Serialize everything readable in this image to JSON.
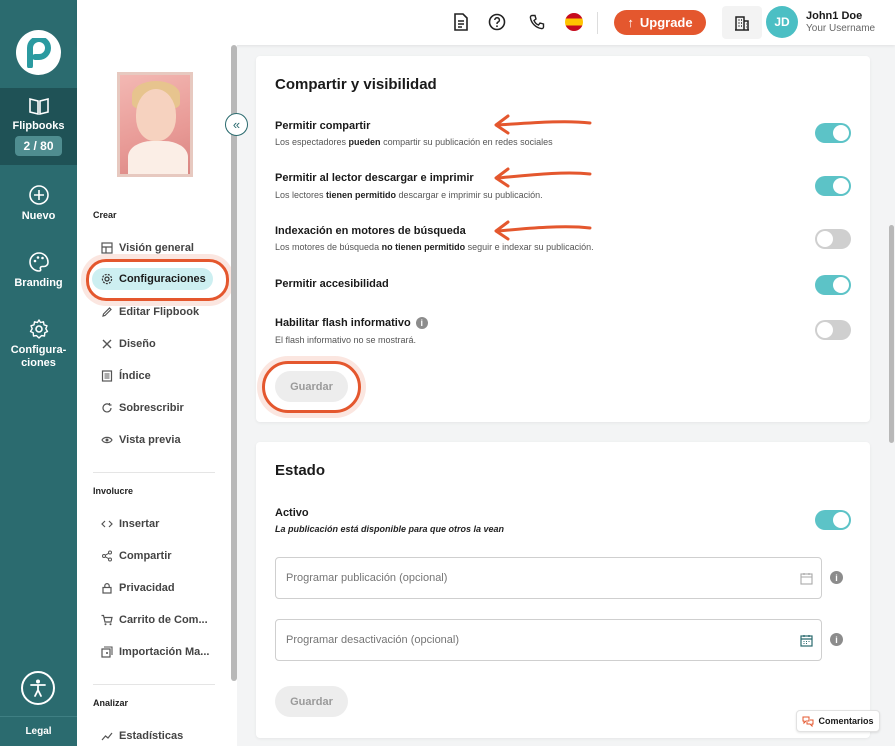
{
  "rail": {
    "flipbooks_label": "Flipbooks",
    "flipbooks_count": "2 / 80",
    "new_label": "Nuevo",
    "branding_label": "Branding",
    "settings_label": "Configura-\nciones",
    "legal_label": "Legal"
  },
  "topbar": {
    "upgrade_label": "Upgrade",
    "avatar_initials": "JD",
    "user_name": "John1 Doe",
    "user_sub": "Your Username"
  },
  "sidebar": {
    "section_crear": "Crear",
    "section_involucre": "Involucre",
    "section_analizar": "Analizar",
    "crear_items": [
      "Visión general",
      "Configuraciones",
      "Editar Flipbook",
      "Diseño",
      "Índice",
      "Sobrescribir",
      "Vista previa"
    ],
    "involucre_items": [
      "Insertar",
      "Compartir",
      "Privacidad",
      "Carrito de Com...",
      "Importación Ma..."
    ],
    "analizar_items": [
      "Estadísticas"
    ]
  },
  "sharing": {
    "title": "Compartir y visibilidad",
    "s1_title": "Permitir compartir",
    "s1_desc_a": "Los espectadores ",
    "s1_desc_b": "pueden",
    "s1_desc_c": " compartir su publicación en redes sociales",
    "s2_title": "Permitir al lector descargar e imprimir",
    "s2_desc_a": "Los lectores ",
    "s2_desc_b": "tienen permitido",
    "s2_desc_c": " descargar e imprimir su publicación.",
    "s3_title": "Indexación en motores de búsqueda",
    "s3_desc_a": "Los motores de búsqueda ",
    "s3_desc_b": "no tienen permitido",
    "s3_desc_c": " seguir e indexar su publicación.",
    "s4_title": "Permitir accesibilidad",
    "s5_title": "Habilitar flash informativo",
    "s5_desc": "El flash informativo no se mostrará.",
    "save_label": "Guardar",
    "toggles": [
      true,
      true,
      false,
      true,
      false
    ]
  },
  "estado": {
    "title": "Estado",
    "active_title": "Activo",
    "active_desc": "La publicación está disponible para que otros la vean",
    "publish_placeholder": "Programar publicación (opcional)",
    "deactivate_placeholder": "Programar desactivación (opcional)",
    "save_label": "Guardar"
  },
  "comments_label": "Comentarios",
  "colors": {
    "rail": "#2b6b6f",
    "accent": "#5cc3c7",
    "highlight": "#e4572e"
  }
}
